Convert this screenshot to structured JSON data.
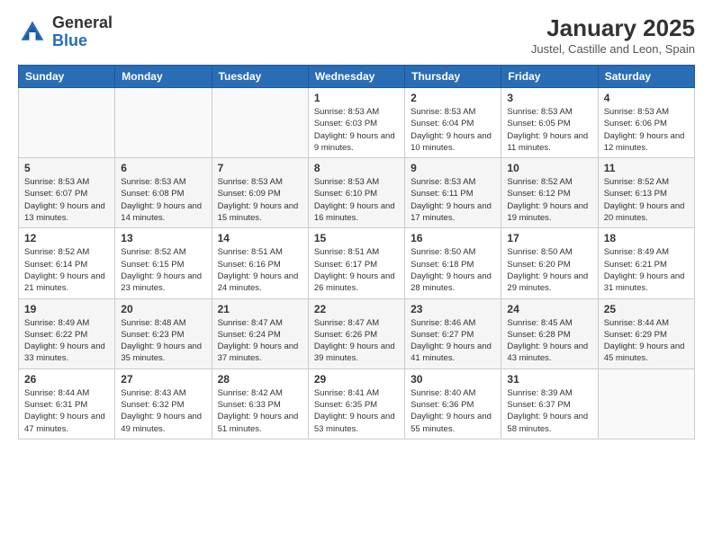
{
  "logo": {
    "general": "General",
    "blue": "Blue"
  },
  "title": "January 2025",
  "subtitle": "Justel, Castille and Leon, Spain",
  "days_of_week": [
    "Sunday",
    "Monday",
    "Tuesday",
    "Wednesday",
    "Thursday",
    "Friday",
    "Saturday"
  ],
  "weeks": [
    [
      {
        "day": "",
        "detail": ""
      },
      {
        "day": "",
        "detail": ""
      },
      {
        "day": "",
        "detail": ""
      },
      {
        "day": "1",
        "detail": "Sunrise: 8:53 AM\nSunset: 6:03 PM\nDaylight: 9 hours and 9 minutes."
      },
      {
        "day": "2",
        "detail": "Sunrise: 8:53 AM\nSunset: 6:04 PM\nDaylight: 9 hours and 10 minutes."
      },
      {
        "day": "3",
        "detail": "Sunrise: 8:53 AM\nSunset: 6:05 PM\nDaylight: 9 hours and 11 minutes."
      },
      {
        "day": "4",
        "detail": "Sunrise: 8:53 AM\nSunset: 6:06 PM\nDaylight: 9 hours and 12 minutes."
      }
    ],
    [
      {
        "day": "5",
        "detail": "Sunrise: 8:53 AM\nSunset: 6:07 PM\nDaylight: 9 hours and 13 minutes."
      },
      {
        "day": "6",
        "detail": "Sunrise: 8:53 AM\nSunset: 6:08 PM\nDaylight: 9 hours and 14 minutes."
      },
      {
        "day": "7",
        "detail": "Sunrise: 8:53 AM\nSunset: 6:09 PM\nDaylight: 9 hours and 15 minutes."
      },
      {
        "day": "8",
        "detail": "Sunrise: 8:53 AM\nSunset: 6:10 PM\nDaylight: 9 hours and 16 minutes."
      },
      {
        "day": "9",
        "detail": "Sunrise: 8:53 AM\nSunset: 6:11 PM\nDaylight: 9 hours and 17 minutes."
      },
      {
        "day": "10",
        "detail": "Sunrise: 8:52 AM\nSunset: 6:12 PM\nDaylight: 9 hours and 19 minutes."
      },
      {
        "day": "11",
        "detail": "Sunrise: 8:52 AM\nSunset: 6:13 PM\nDaylight: 9 hours and 20 minutes."
      }
    ],
    [
      {
        "day": "12",
        "detail": "Sunrise: 8:52 AM\nSunset: 6:14 PM\nDaylight: 9 hours and 21 minutes."
      },
      {
        "day": "13",
        "detail": "Sunrise: 8:52 AM\nSunset: 6:15 PM\nDaylight: 9 hours and 23 minutes."
      },
      {
        "day": "14",
        "detail": "Sunrise: 8:51 AM\nSunset: 6:16 PM\nDaylight: 9 hours and 24 minutes."
      },
      {
        "day": "15",
        "detail": "Sunrise: 8:51 AM\nSunset: 6:17 PM\nDaylight: 9 hours and 26 minutes."
      },
      {
        "day": "16",
        "detail": "Sunrise: 8:50 AM\nSunset: 6:18 PM\nDaylight: 9 hours and 28 minutes."
      },
      {
        "day": "17",
        "detail": "Sunrise: 8:50 AM\nSunset: 6:20 PM\nDaylight: 9 hours and 29 minutes."
      },
      {
        "day": "18",
        "detail": "Sunrise: 8:49 AM\nSunset: 6:21 PM\nDaylight: 9 hours and 31 minutes."
      }
    ],
    [
      {
        "day": "19",
        "detail": "Sunrise: 8:49 AM\nSunset: 6:22 PM\nDaylight: 9 hours and 33 minutes."
      },
      {
        "day": "20",
        "detail": "Sunrise: 8:48 AM\nSunset: 6:23 PM\nDaylight: 9 hours and 35 minutes."
      },
      {
        "day": "21",
        "detail": "Sunrise: 8:47 AM\nSunset: 6:24 PM\nDaylight: 9 hours and 37 minutes."
      },
      {
        "day": "22",
        "detail": "Sunrise: 8:47 AM\nSunset: 6:26 PM\nDaylight: 9 hours and 39 minutes."
      },
      {
        "day": "23",
        "detail": "Sunrise: 8:46 AM\nSunset: 6:27 PM\nDaylight: 9 hours and 41 minutes."
      },
      {
        "day": "24",
        "detail": "Sunrise: 8:45 AM\nSunset: 6:28 PM\nDaylight: 9 hours and 43 minutes."
      },
      {
        "day": "25",
        "detail": "Sunrise: 8:44 AM\nSunset: 6:29 PM\nDaylight: 9 hours and 45 minutes."
      }
    ],
    [
      {
        "day": "26",
        "detail": "Sunrise: 8:44 AM\nSunset: 6:31 PM\nDaylight: 9 hours and 47 minutes."
      },
      {
        "day": "27",
        "detail": "Sunrise: 8:43 AM\nSunset: 6:32 PM\nDaylight: 9 hours and 49 minutes."
      },
      {
        "day": "28",
        "detail": "Sunrise: 8:42 AM\nSunset: 6:33 PM\nDaylight: 9 hours and 51 minutes."
      },
      {
        "day": "29",
        "detail": "Sunrise: 8:41 AM\nSunset: 6:35 PM\nDaylight: 9 hours and 53 minutes."
      },
      {
        "day": "30",
        "detail": "Sunrise: 8:40 AM\nSunset: 6:36 PM\nDaylight: 9 hours and 55 minutes."
      },
      {
        "day": "31",
        "detail": "Sunrise: 8:39 AM\nSunset: 6:37 PM\nDaylight: 9 hours and 58 minutes."
      },
      {
        "day": "",
        "detail": ""
      }
    ]
  ]
}
